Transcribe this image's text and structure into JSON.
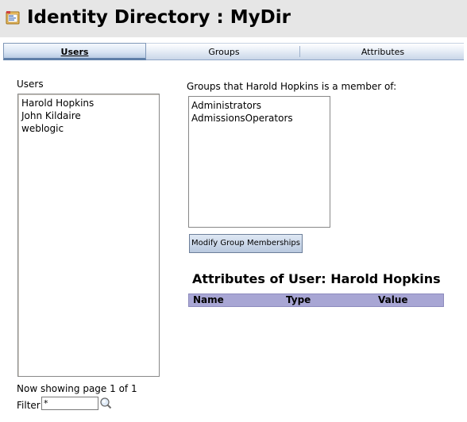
{
  "header": {
    "title": "Identity Directory : MyDir",
    "icon": "directory-icon"
  },
  "tabs": [
    {
      "label": "Users",
      "active": true
    },
    {
      "label": "Groups",
      "active": false
    },
    {
      "label": "Attributes",
      "active": false
    }
  ],
  "users_panel": {
    "label": "Users",
    "items": [
      "Harold Hopkins",
      "John Kildaire",
      "weblogic"
    ],
    "page_info": "Now showing page 1 of 1",
    "filter_label": "Filter",
    "filter_value": "*"
  },
  "groups_panel": {
    "label": "Groups that Harold Hopkins is a member of:",
    "items": [
      "Administrators",
      "AdmissionsOperators"
    ],
    "modify_button": "Modify Group Memberships"
  },
  "attributes_panel": {
    "title": "Attributes of User: Harold Hopkins",
    "columns": [
      "Name",
      "Type",
      "Value"
    ]
  },
  "colors": {
    "header_bg": "#e6e6e6",
    "table_header_bg": "#a8a6d4"
  }
}
